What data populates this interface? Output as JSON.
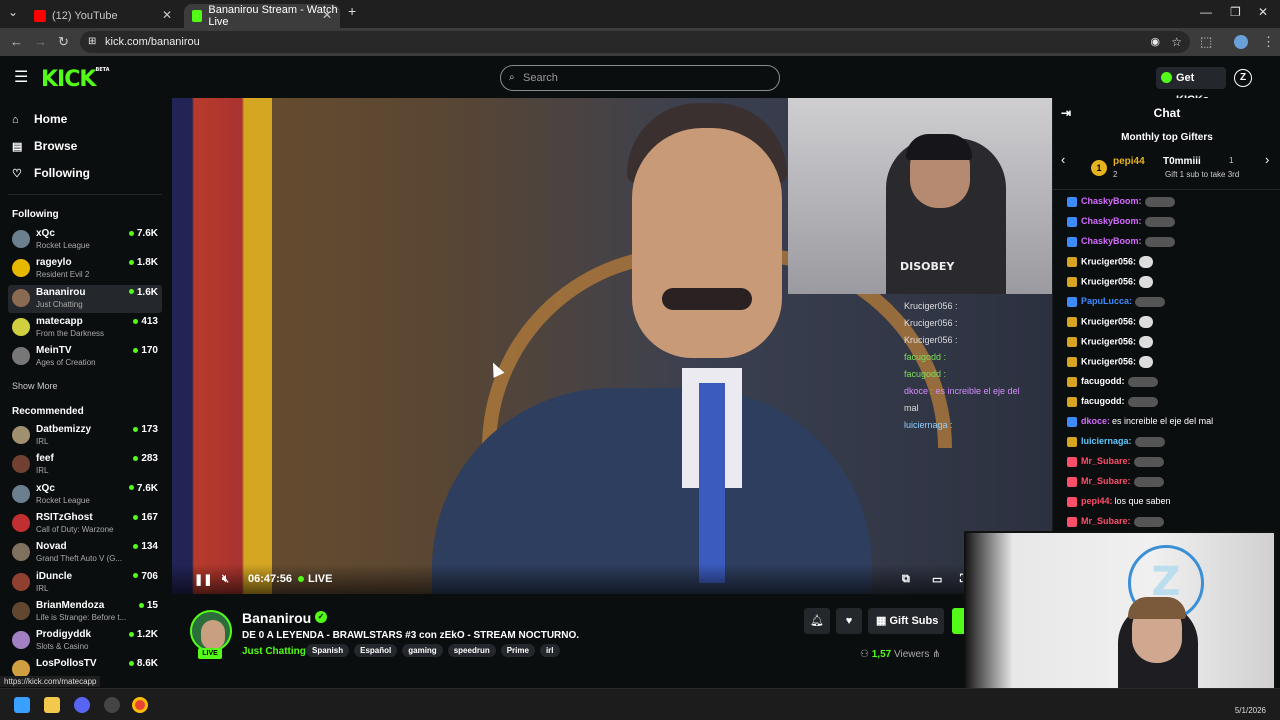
{
  "browser": {
    "tabs": [
      {
        "title": "(12) YouTube",
        "favicon": "youtube-icon"
      },
      {
        "title": "Bananirou Stream - Watch Live",
        "favicon": "kick-icon"
      }
    ],
    "url": "kick.com/bananirou",
    "status_url": "https://kick.com/matecapp"
  },
  "header": {
    "logo": "KICK",
    "beta": "BETA",
    "search_placeholder": "Search",
    "get_kicks": "Get KICKs",
    "profile_initial": "Z"
  },
  "sidebar": {
    "nav": [
      {
        "label": "Home",
        "icon": "home-icon"
      },
      {
        "label": "Browse",
        "icon": "browse-icon"
      },
      {
        "label": "Following",
        "icon": "heart-icon"
      }
    ],
    "following_title": "Following",
    "following": [
      {
        "name": "xQc",
        "category": "Rocket League",
        "viewers": "7.6K",
        "color": "#6b7f8f"
      },
      {
        "name": "rageylo",
        "category": "Resident Evil 2",
        "viewers": "1.8K",
        "color": "#e6b800"
      },
      {
        "name": "Bananirou",
        "category": "Just Chatting",
        "viewers": "1.6K",
        "color": "#8a6a50"
      },
      {
        "name": "matecapp",
        "category": "From the Darkness",
        "viewers": "413",
        "color": "#cfcf40"
      },
      {
        "name": "MeinTV",
        "category": "Ages of Creation",
        "viewers": "170",
        "color": "#777"
      }
    ],
    "show_more": "Show More",
    "recommended_title": "Recommended",
    "recommended": [
      {
        "name": "Datbemizzy",
        "category": "IRL",
        "viewers": "173",
        "color": "#a09070"
      },
      {
        "name": "feef",
        "category": "IRL",
        "viewers": "283",
        "color": "#704030"
      },
      {
        "name": "xQc",
        "category": "Rocket League",
        "viewers": "7.6K",
        "color": "#6b7f8f"
      },
      {
        "name": "RSITzGhost",
        "category": "Call of Duty: Warzone",
        "viewers": "167",
        "color": "#c03030"
      },
      {
        "name": "Novad",
        "category": "Grand Theft Auto V (G...",
        "viewers": "134",
        "color": "#807060"
      },
      {
        "name": "iDuncle",
        "category": "IRL",
        "viewers": "706",
        "color": "#904030"
      },
      {
        "name": "BrianMendoza",
        "category": "Life is Strange: Before t...",
        "viewers": "15",
        "color": "#604830"
      },
      {
        "name": "Prodigyddk",
        "category": "Slots & Casino",
        "viewers": "1.2K",
        "color": "#a080c0"
      },
      {
        "name": "LosPollosTV",
        "category": "",
        "viewers": "8.6K",
        "color": "#d0a040"
      }
    ]
  },
  "video": {
    "time": "06:47:56",
    "live": "LIVE",
    "shirt_text": "DISOBEY",
    "overlay_chat": [
      {
        "user": "Kruciger056 :",
        "cls": "n"
      },
      {
        "user": "Kruciger056 :",
        "cls": "n"
      },
      {
        "user": "Kruciger056 :",
        "cls": "n"
      },
      {
        "user": "facugodd :",
        "cls": "g"
      },
      {
        "user": "facugodd :",
        "cls": "g"
      },
      {
        "user": "dkoce : es increible el eje del",
        "cls": "p"
      },
      {
        "user": "mal",
        "cls": "n"
      },
      {
        "user": "luiciernaga :",
        "cls": "c"
      }
    ]
  },
  "stream": {
    "name": "Bananirou",
    "live_badge": "LIVE",
    "title": "DE 0 A LEYENDA - BRAWLSTARS #3 con zEkO - STREAM NOCTURNO.",
    "category": "Just Chatting",
    "tags": [
      "Spanish",
      "Español",
      "gaming",
      "speedrun",
      "Prime",
      "irl"
    ],
    "gift_subs": "Gift Subs",
    "viewers_count": "1,57",
    "viewers_label": "Viewers"
  },
  "chat": {
    "title": "Chat",
    "gifters_title": "Monthly top Gifters",
    "gifter1": {
      "rank": "1",
      "name": "pepi44",
      "count": "2"
    },
    "gifter2": {
      "name": "T0mmiii",
      "count": "1",
      "note": "Gift 1 sub to take 3rd"
    },
    "messages": [
      {
        "user": "ChaskyBoom:",
        "color": "#d46bff",
        "text": ""
      },
      {
        "user": "ChaskyBoom:",
        "color": "#d46bff",
        "text": ""
      },
      {
        "user": "ChaskyBoom:",
        "color": "#d46bff",
        "text": ""
      },
      {
        "user": "Kruciger056:",
        "color": "#ffffff",
        "text": ""
      },
      {
        "user": "Kruciger056:",
        "color": "#ffffff",
        "text": ""
      },
      {
        "user": "PapuLucca:",
        "color": "#3d8bff",
        "text": ""
      },
      {
        "user": "Kruciger056:",
        "color": "#ffffff",
        "text": ""
      },
      {
        "user": "Kruciger056:",
        "color": "#ffffff",
        "text": ""
      },
      {
        "user": "Kruciger056:",
        "color": "#ffffff",
        "text": ""
      },
      {
        "user": "facugodd:",
        "color": "#ffffff",
        "text": ""
      },
      {
        "user": "facugodd:",
        "color": "#ffffff",
        "text": ""
      },
      {
        "user": "dkoce:",
        "color": "#d46bff",
        "text": "es increible el eje del mal"
      },
      {
        "user": "luiciernaga:",
        "color": "#5ec8ff",
        "text": ""
      },
      {
        "user": "Mr_Subare:",
        "color": "#ff4d6a",
        "text": ""
      },
      {
        "user": "Mr_Subare:",
        "color": "#ff4d6a",
        "text": ""
      },
      {
        "user": "pepi44:",
        "color": "#ff4d6a",
        "text": "los que saben"
      },
      {
        "user": "Mr_Subare:",
        "color": "#ff4d6a",
        "text": ""
      }
    ]
  },
  "taskbar": {
    "date": "5/1/2026"
  },
  "colors": {
    "accent": "#53fc18",
    "bg": "#0b0e0f",
    "panel": "#24272c"
  }
}
